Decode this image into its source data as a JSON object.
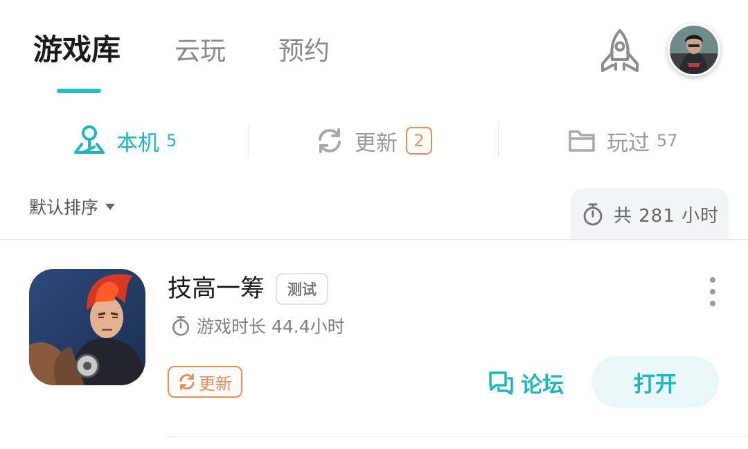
{
  "top_tabs": [
    {
      "label": "游戏库",
      "active": true
    },
    {
      "label": "云玩",
      "active": false
    },
    {
      "label": "预约",
      "active": false
    }
  ],
  "header_icons": {
    "rocket": "rocket-icon",
    "avatar": "user-avatar"
  },
  "sub_tabs": [
    {
      "label": "本机",
      "count": "5",
      "icon": "location-pin-icon",
      "active": true
    },
    {
      "label": "更新",
      "badge": "2",
      "icon": "refresh-icon",
      "active": false
    },
    {
      "label": "玩过",
      "count": "57",
      "icon": "folder-icon",
      "active": false
    }
  ],
  "sort": {
    "label": "默认排序"
  },
  "total": {
    "text": "共 281 小时",
    "icon": "stopwatch-icon"
  },
  "games": [
    {
      "title": "技高一筹",
      "tag": "测试",
      "play_time": "游戏时长 44.4小时",
      "update_label": "更新",
      "forum_label": "论坛",
      "open_label": "打开"
    }
  ],
  "colors": {
    "accent": "#1fb6c0",
    "update": "#f08a55",
    "open_bg": "#e8f7f8"
  }
}
